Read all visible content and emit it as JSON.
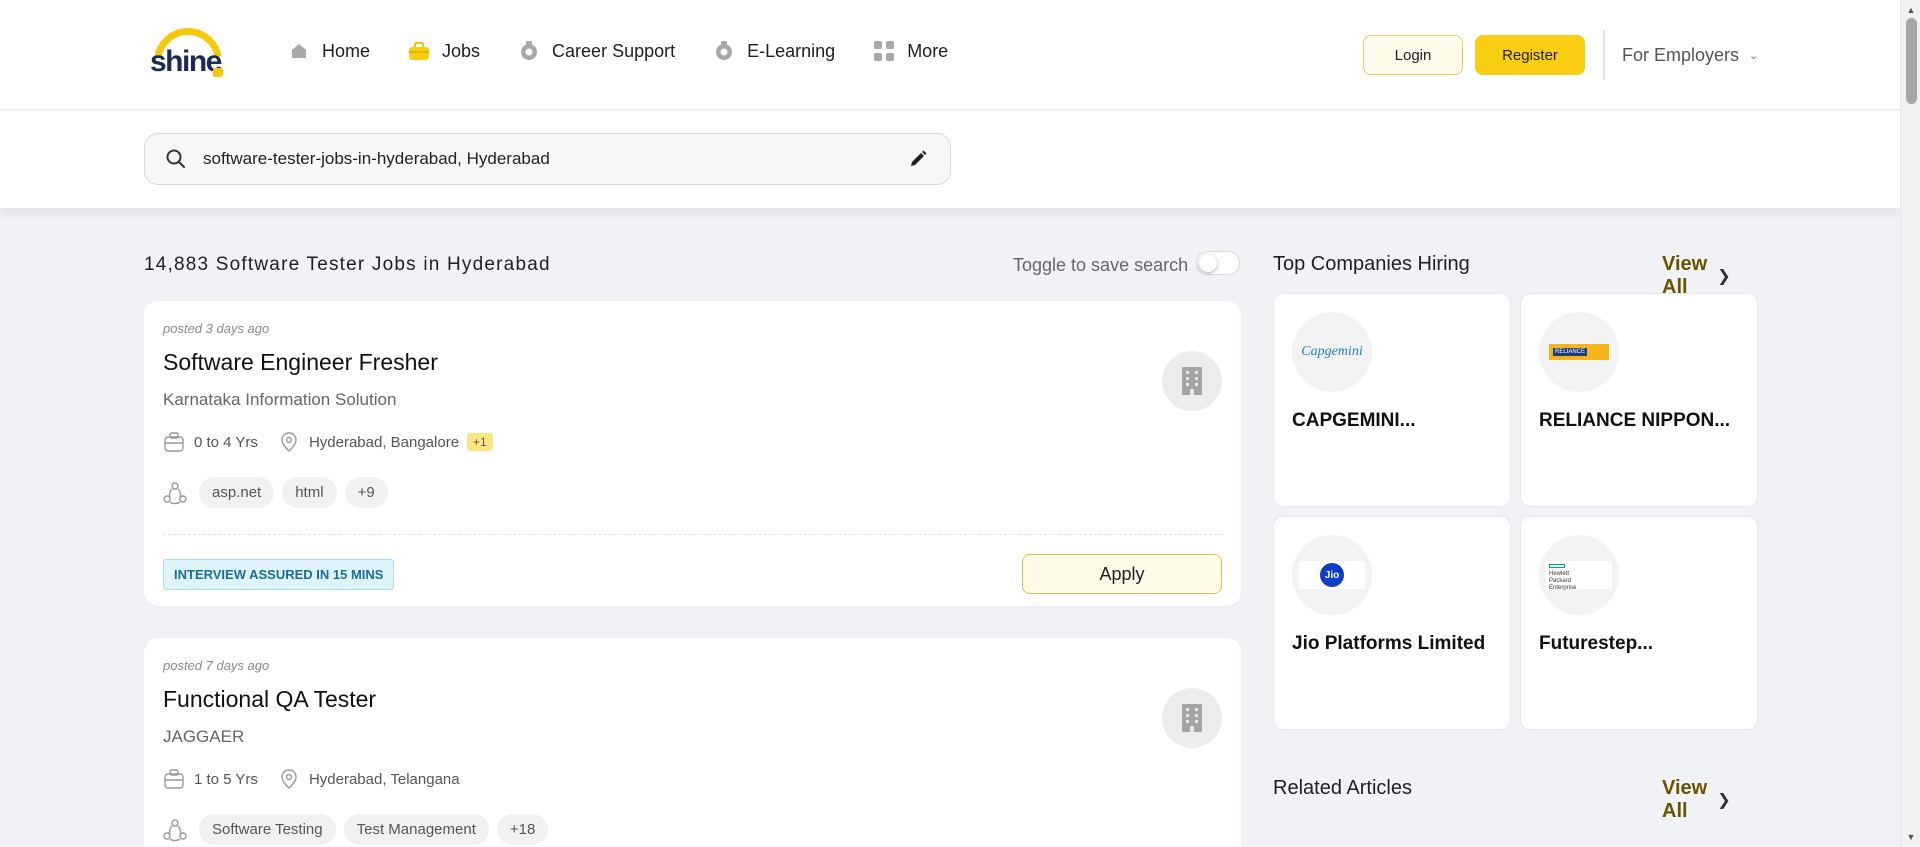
{
  "header": {
    "logo_text": "shine",
    "nav": [
      {
        "label": "Home",
        "icon": "home-icon"
      },
      {
        "label": "Jobs",
        "icon": "briefcase-icon"
      },
      {
        "label": "Career Support",
        "icon": "career-support-icon"
      },
      {
        "label": "E-Learning",
        "icon": "elearning-icon"
      },
      {
        "label": "More",
        "icon": "grid-icon"
      }
    ],
    "login_label": "Login",
    "register_label": "Register",
    "employers_label": "For Employers"
  },
  "search": {
    "value": "software-tester-jobs-in-hyderabad, Hyderabad"
  },
  "results": {
    "title": "14,883 Software Tester Jobs in Hyderabad",
    "toggle_label": "Toggle to save search",
    "toggle_on": false
  },
  "jobs": [
    {
      "posted": "posted 3 days ago",
      "title": "Software Engineer Fresher",
      "company": "Karnataka Information Solution",
      "experience": "0 to 4 Yrs",
      "location": "Hyderabad, Bangalore",
      "location_extra": "+1",
      "skills": [
        "asp.net",
        "html",
        "+9"
      ],
      "badge": "INTERVIEW ASSURED IN 15 MINS",
      "apply_label": "Apply"
    },
    {
      "posted": "posted 7 days ago",
      "title": "Functional QA Tester",
      "company": "JAGGAER",
      "experience": "1 to 5 Yrs",
      "location": "Hyderabad, Telangana",
      "skills": [
        "Software Testing",
        "Test Management",
        "+18"
      ]
    }
  ],
  "sidebar": {
    "top_companies_title": "Top Companies Hiring",
    "view_all_label": "View All",
    "companies": [
      {
        "name": "CAPGEMINI...",
        "logo_text": "Capgemini"
      },
      {
        "name": "RELIANCE NIPPON...",
        "logo_text": "RELIANCE"
      },
      {
        "name": "Jio Platforms Limited",
        "logo_text": "Jio"
      },
      {
        "name": "Futurestep...",
        "logo_text": "Hewlett Packard Enterprise"
      }
    ],
    "related_articles_title": "Related Articles",
    "related_view_all_label": "View All"
  },
  "colors": {
    "brand_yellow": "#f8cd12",
    "accent_text": "#6a5300",
    "background": "#f1f2f6"
  }
}
